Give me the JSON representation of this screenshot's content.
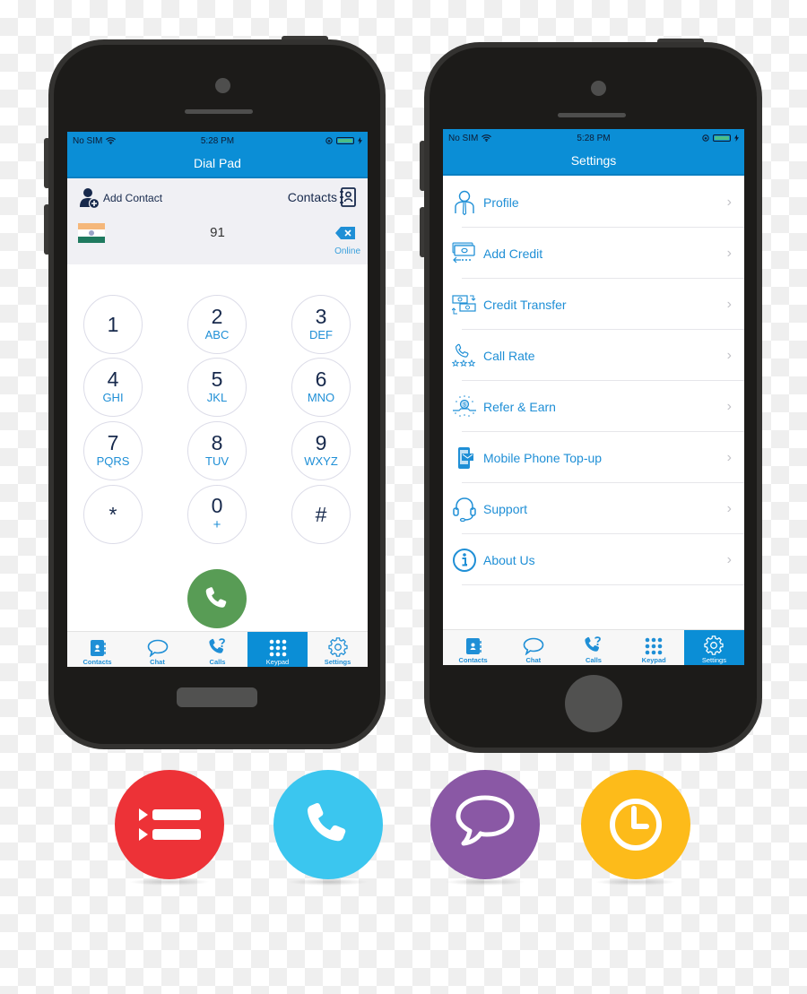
{
  "status_bar": {
    "carrier": "No SIM",
    "time": "5:28 PM"
  },
  "dial_screen": {
    "title": "Dial Pad",
    "add_contact_label": "Add Contact",
    "contacts_label": "Contacts",
    "country_flag": "india-flag",
    "number": "91",
    "connection_status": "Online",
    "keys": [
      {
        "digit": "1",
        "letters": ""
      },
      {
        "digit": "2",
        "letters": "ABC"
      },
      {
        "digit": "3",
        "letters": "DEF"
      },
      {
        "digit": "4",
        "letters": "GHI"
      },
      {
        "digit": "5",
        "letters": "JKL"
      },
      {
        "digit": "6",
        "letters": "MNO"
      },
      {
        "digit": "7",
        "letters": "PQRS"
      },
      {
        "digit": "8",
        "letters": "TUV"
      },
      {
        "digit": "9",
        "letters": "WXYZ"
      },
      {
        "digit": "*",
        "letters": ""
      },
      {
        "digit": "0",
        "letters": "+"
      },
      {
        "digit": "#",
        "letters": ""
      }
    ],
    "active_tab": "Keypad"
  },
  "settings_screen": {
    "title": "Settings",
    "items": [
      {
        "label": "Profile",
        "icon": "profile-icon"
      },
      {
        "label": "Add Credit",
        "icon": "add-credit-icon"
      },
      {
        "label": "Credit Transfer",
        "icon": "credit-transfer-icon"
      },
      {
        "label": "Call Rate",
        "icon": "call-rate-icon"
      },
      {
        "label": "Refer & Earn",
        "icon": "refer-earn-icon"
      },
      {
        "label": "Mobile Phone Top-up",
        "icon": "mobile-topup-icon"
      },
      {
        "label": "Support",
        "icon": "support-icon"
      },
      {
        "label": "About Us",
        "icon": "about-icon"
      }
    ],
    "active_tab": "Settings"
  },
  "tabs": [
    {
      "label": "Contacts",
      "icon": "contacts-book-icon"
    },
    {
      "label": "Chat",
      "icon": "chat-bubble-icon"
    },
    {
      "label": "Calls",
      "icon": "call-question-icon"
    },
    {
      "label": "Keypad",
      "icon": "keypad-grid-icon"
    },
    {
      "label": "Settings",
      "icon": "gear-icon"
    }
  ],
  "feature_icons": [
    {
      "name": "list-icon",
      "color": "#ed3237"
    },
    {
      "name": "phone-icon",
      "color": "#3bc6ef"
    },
    {
      "name": "chat-icon",
      "color": "#8a58a5"
    },
    {
      "name": "clock-icon",
      "color": "#fdbb1a"
    }
  ],
  "colors": {
    "primary_blue": "#0b8ed6",
    "call_green": "#589c55",
    "text_dark": "#17294c"
  }
}
